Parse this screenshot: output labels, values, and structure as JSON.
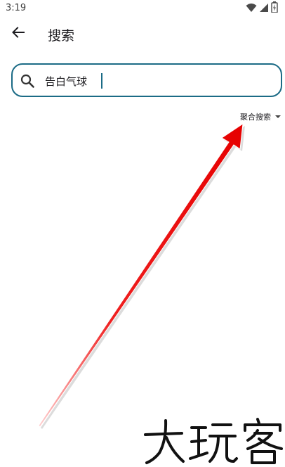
{
  "status_bar": {
    "time": "3:19",
    "icons": [
      "wifi-icon",
      "cellular-signal-icon",
      "battery-icon"
    ]
  },
  "app_bar": {
    "back_icon": "arrow-left-icon",
    "title": "搜索"
  },
  "search": {
    "icon": "search-icon",
    "value": "告白气球",
    "border_color": "#1b6b86"
  },
  "search_mode": {
    "label": "聚合搜索",
    "icon": "caret-down-icon"
  },
  "annotation": {
    "arrow_color": "#e8000a"
  },
  "watermark": {
    "text": "大玩客"
  }
}
